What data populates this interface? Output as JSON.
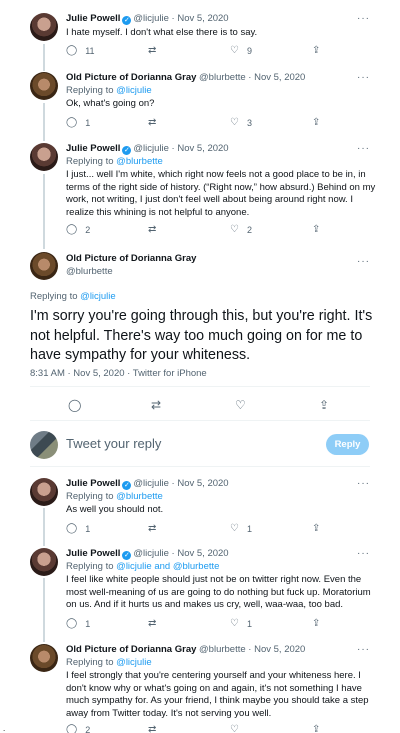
{
  "tweets_above": [
    {
      "name": "Julie Powell",
      "handle": "@licjulie",
      "date": "· Nov 5, 2020",
      "reply_to_label": "",
      "reply_to_link": "",
      "text": "I hate myself. I don't what else there is to say.",
      "reply_count": "11",
      "retweet_count": "",
      "like_count": "9"
    },
    {
      "name": "Old Picture of Dorianna Gray",
      "handle": "@blurbette",
      "date": "· Nov 5, 2020",
      "reply_to_label": "Replying to",
      "reply_to_link": "@licjulie",
      "text": "Ok, what's going on?",
      "reply_count": "1",
      "retweet_count": "",
      "like_count": "3"
    },
    {
      "name": "Julie Powell",
      "handle": "@licjulie",
      "date": "· Nov 5, 2020",
      "reply_to_label": "Replying to",
      "reply_to_link": "@blurbette",
      "text": "I just... well I'm white, which right now feels not a good place to be in, in terms of the right side of history. (“Right now,” how absurd.) Behind on my work, not writing, I just don't feel well about being around right now. I realize this whining is not helpful to anyone.",
      "reply_count": "2",
      "retweet_count": "",
      "like_count": "2"
    }
  ],
  "main_tweet": {
    "name": "Old Picture of Dorianna Gray",
    "handle": "@blurbette",
    "reply_to_label": "Replying to",
    "reply_to_link": "@licjulie",
    "text": "I'm sorry you're going through this, but you're right. It's not helpful. There's way too much going on for me to have sympathy for your whiteness.",
    "meta": "8:31 AM · Nov 5, 2020 · Twitter for iPhone"
  },
  "composer": {
    "placeholder": "Tweet your reply",
    "button": "Reply"
  },
  "tweets_below": [
    {
      "name": "Julie Powell",
      "handle": "@licjulie",
      "date": "· Nov 5, 2020",
      "reply_to_label": "Replying to",
      "reply_to_link": "@blurbette",
      "text": "As well you should not.",
      "reply_count": "1",
      "retweet_count": "",
      "like_count": "1"
    },
    {
      "name": "Julie Powell",
      "handle": "@licjulie",
      "date": "· Nov 5, 2020",
      "reply_to_label": "Replying to",
      "reply_to_link": "@licjulie and @blurbette",
      "text": "I feel like white people should just not be on twitter right now. Even the most well-meaning of us are going to do nothing but fuck up. Moratorium on us. And if it hurts us and makes us cry, well, waa-waa, too bad.",
      "reply_count": "1",
      "retweet_count": "",
      "like_count": "1"
    },
    {
      "name": "Old Picture of Dorianna Gray",
      "handle": "@blurbette",
      "date": "· Nov 5, 2020",
      "reply_to_label": "Replying to",
      "reply_to_link": "@licjulie",
      "text": "I feel strongly that you're centering yourself and your whiteness here. I don't know why or what's going on and again, it's not something I have much sympathy for. As your friend, I think maybe you should take a step away from Twitter today. It's not serving you well.",
      "reply_count": "2",
      "retweet_count": "",
      "like_count": ""
    }
  ],
  "icons": {
    "reply": "reply-icon",
    "retweet": "retweet-icon",
    "like": "heart-icon",
    "share": "share-icon",
    "more": "more-icon",
    "verified": "verified-badge-icon"
  },
  "colors": {
    "accent": "#1d9bf0",
    "muted": "#536471",
    "reply_button_disabled": "#8ecdf7"
  },
  "misc": {
    "edge_dot": "."
  }
}
